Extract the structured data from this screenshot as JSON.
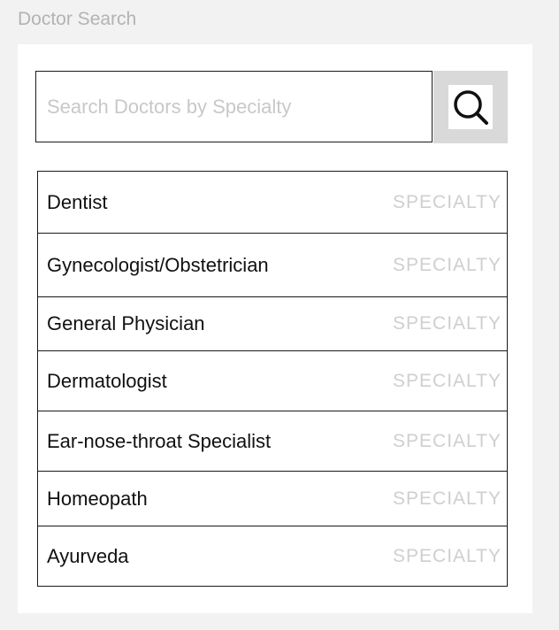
{
  "frame": {
    "title": "Doctor Search"
  },
  "search": {
    "placeholder": "Search Doctors by Specialty",
    "value": "",
    "button_icon": "search-icon"
  },
  "results": [
    {
      "name": "Dentist",
      "tag": "SPECIALTY"
    },
    {
      "name": "Gynecologist/Obstetrician",
      "tag": "SPECIALTY"
    },
    {
      "name": "General Physician",
      "tag": "SPECIALTY"
    },
    {
      "name": "Dermatologist",
      "tag": "SPECIALTY"
    },
    {
      "name": "Ear-nose-throat Specialist",
      "tag": "SPECIALTY"
    },
    {
      "name": "Homeopath",
      "tag": "SPECIALTY"
    },
    {
      "name": "Ayurveda",
      "tag": "SPECIALTY"
    }
  ]
}
